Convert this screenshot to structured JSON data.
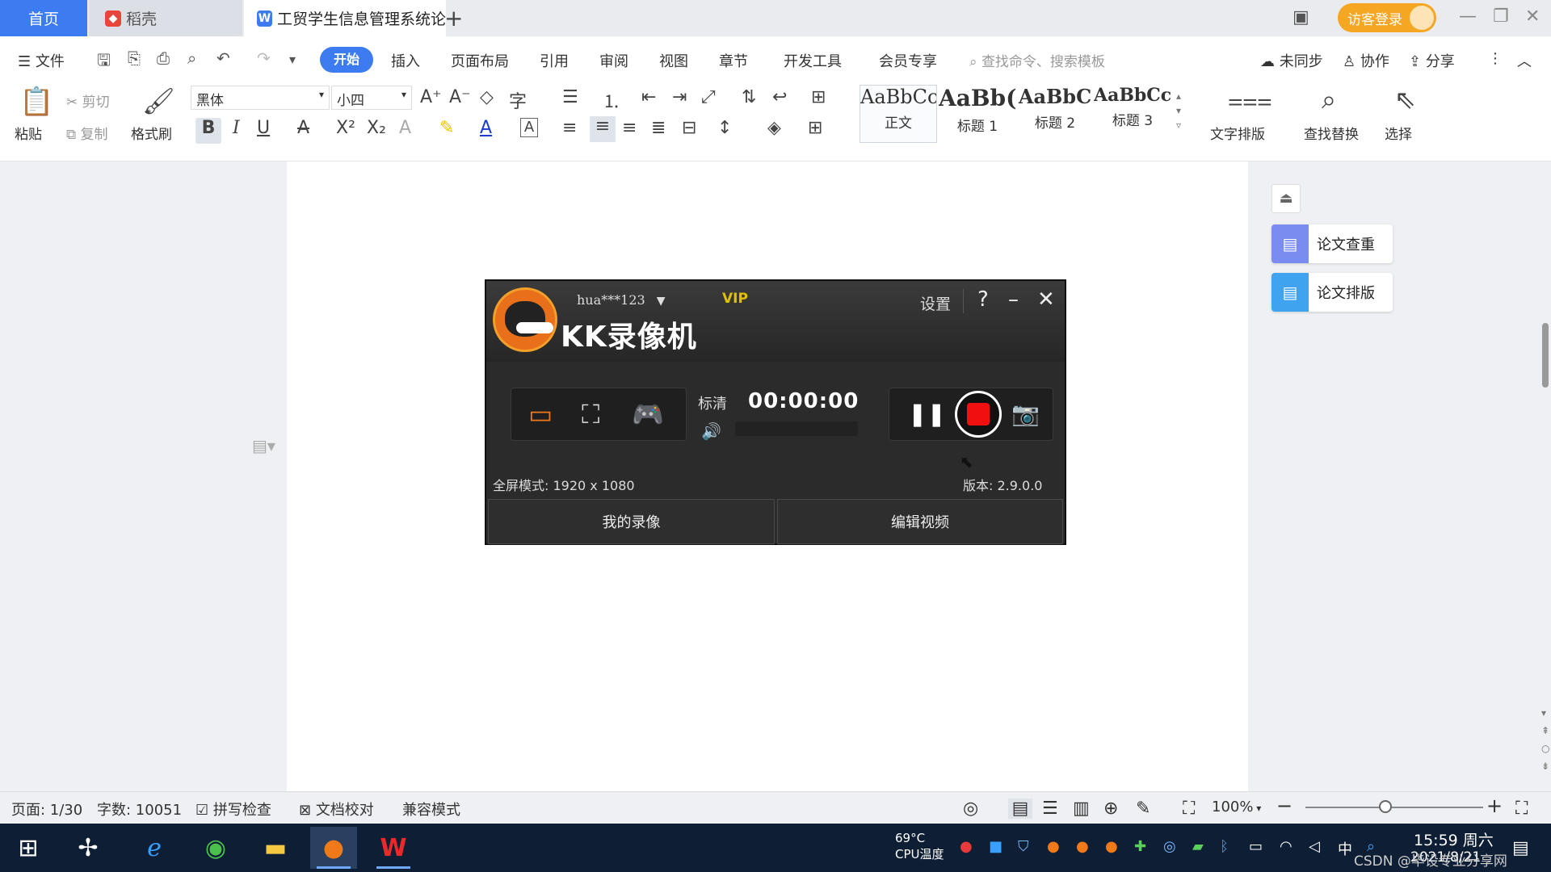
{
  "tabs": {
    "home": "首页",
    "daoke": "稻壳",
    "doc": "工贸学生信息管理系统论",
    "new_tab": "+"
  },
  "titlebar": {
    "login": "访客登录"
  },
  "menu": {
    "file": "文件",
    "items": [
      "开始",
      "插入",
      "页面布局",
      "引用",
      "审阅",
      "视图",
      "章节",
      "开发工具",
      "会员专享"
    ],
    "search_placeholder": "查找命令、搜索模板",
    "sync": "未同步",
    "collab": "协作",
    "share": "分享"
  },
  "toolbar": {
    "paste": "粘贴",
    "cut": "剪切",
    "copy": "复制",
    "format_painter": "格式刷",
    "font_name": "黑体",
    "font_size": "小四",
    "styles": [
      {
        "sample": "AaBbCcI",
        "label": "正文"
      },
      {
        "sample": "AaBb(",
        "label": "标题 1"
      },
      {
        "sample": "AaBbC",
        "label": "标题 2"
      },
      {
        "sample": "AaBbCcl",
        "label": "标题 3"
      }
    ],
    "text_layout": "文字排版",
    "find_replace": "查找替换",
    "select": "选择"
  },
  "side_panel": {
    "check": "论文查重",
    "layout": "论文排版"
  },
  "recorder": {
    "username": "hua***123",
    "vip": "VIP",
    "settings": "设置",
    "title": "KK录像机",
    "quality": "标清",
    "timer": "00:00:00",
    "fullscreen_info": "全屏模式: 1920 x 1080",
    "version": "版本: 2.9.0.0",
    "my_recordings": "我的录像",
    "edit_video": "编辑视频"
  },
  "statusbar": {
    "page": "页面: 1/30",
    "word_count": "字数: 10051",
    "spell_check": "拼写检查",
    "proofread": "文档校对",
    "compat_mode": "兼容模式",
    "zoom": "100%"
  },
  "taskbar": {
    "cpu_temp": "69°C",
    "cpu_label": "CPU温度",
    "ime": "中",
    "time": "15:59 周六",
    "date": "2021/8/21",
    "watermark": "CSDN @毕设专业分享网"
  },
  "colors": {
    "accent": "#3c7cf0",
    "login_btn": "#f5a623",
    "kk_bg": "#2b2b2b",
    "record_red": "#f01010",
    "taskbar": "#0e1f35"
  }
}
